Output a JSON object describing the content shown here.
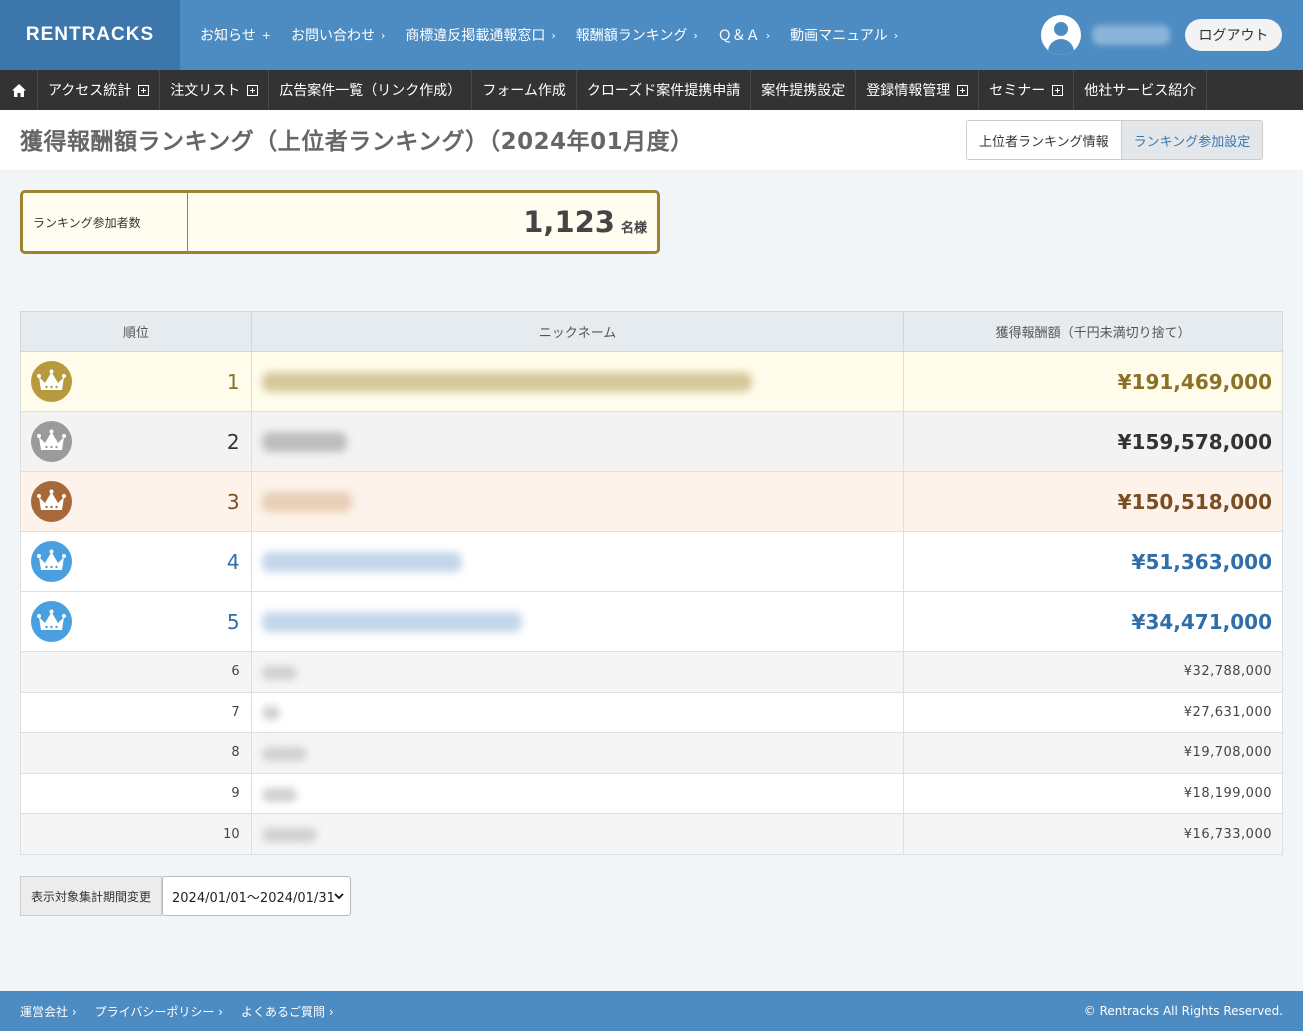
{
  "header": {
    "logo": "RENTRACKS",
    "nav": [
      {
        "label": "お知らせ",
        "chev": "+"
      },
      {
        "label": "お問い合わせ",
        "chev": "›"
      },
      {
        "label": "商標違反掲載通報窓口",
        "chev": "›"
      },
      {
        "label": "報酬額ランキング",
        "chev": "›"
      },
      {
        "label": "Ｑ＆Ａ",
        "chev": "›"
      },
      {
        "label": "動画マニュアル",
        "chev": "›"
      }
    ],
    "logout_label": "ログアウト"
  },
  "mainnav": {
    "items": [
      {
        "label": "アクセス統計",
        "expandable": true
      },
      {
        "label": "注文リスト",
        "expandable": true
      },
      {
        "label": "広告案件一覧（リンク作成）",
        "expandable": false
      },
      {
        "label": "フォーム作成",
        "expandable": false
      },
      {
        "label": "クローズド案件提携申請",
        "expandable": false
      },
      {
        "label": "案件提携設定",
        "expandable": false
      },
      {
        "label": "登録情報管理",
        "expandable": true
      },
      {
        "label": "セミナー",
        "expandable": true
      },
      {
        "label": "他社サービス紹介",
        "expandable": false
      }
    ]
  },
  "page": {
    "title": "獲得報酬額ランキング（上位者ランキング）（2024年01月度）",
    "tabs": [
      "上位者ランキング情報",
      "ランキング参加設定"
    ]
  },
  "participants": {
    "label": "ランキング参加者数",
    "count": "1,123",
    "unit": "名様"
  },
  "ranking": {
    "headers": [
      "順位",
      "ニックネーム",
      "獲得報酬額（千円未満切り捨て）"
    ],
    "rows": [
      {
        "rank": "1",
        "amount": "¥191,469,000",
        "tier": "gold",
        "medal_color": "#b79a3d"
      },
      {
        "rank": "2",
        "amount": "¥159,578,000",
        "tier": "silver",
        "medal_color": "#9b9b9b"
      },
      {
        "rank": "3",
        "amount": "¥150,518,000",
        "tier": "bronze",
        "medal_color": "#a8693a"
      },
      {
        "rank": "4",
        "amount": "¥51,363,000",
        "tier": "blue",
        "medal_color": "#4a9fe0"
      },
      {
        "rank": "5",
        "amount": "¥34,471,000",
        "tier": "blue",
        "medal_color": "#4a9fe0"
      },
      {
        "rank": "6",
        "amount": "¥32,788,000",
        "tier": "plain"
      },
      {
        "rank": "7",
        "amount": "¥27,631,000",
        "tier": "plain"
      },
      {
        "rank": "8",
        "amount": "¥19,708,000",
        "tier": "plain"
      },
      {
        "rank": "9",
        "amount": "¥18,199,000",
        "tier": "plain"
      },
      {
        "rank": "10",
        "amount": "¥16,733,000",
        "tier": "plain"
      }
    ]
  },
  "period": {
    "button_label": "表示対象集計期間変更",
    "selected": "2024/01/01～2024/01/31"
  },
  "footer": {
    "links": [
      "運営会社",
      "プライバシーポリシー",
      "よくあるご質問"
    ],
    "copyright": "© Rentracks All Rights Reserved."
  }
}
